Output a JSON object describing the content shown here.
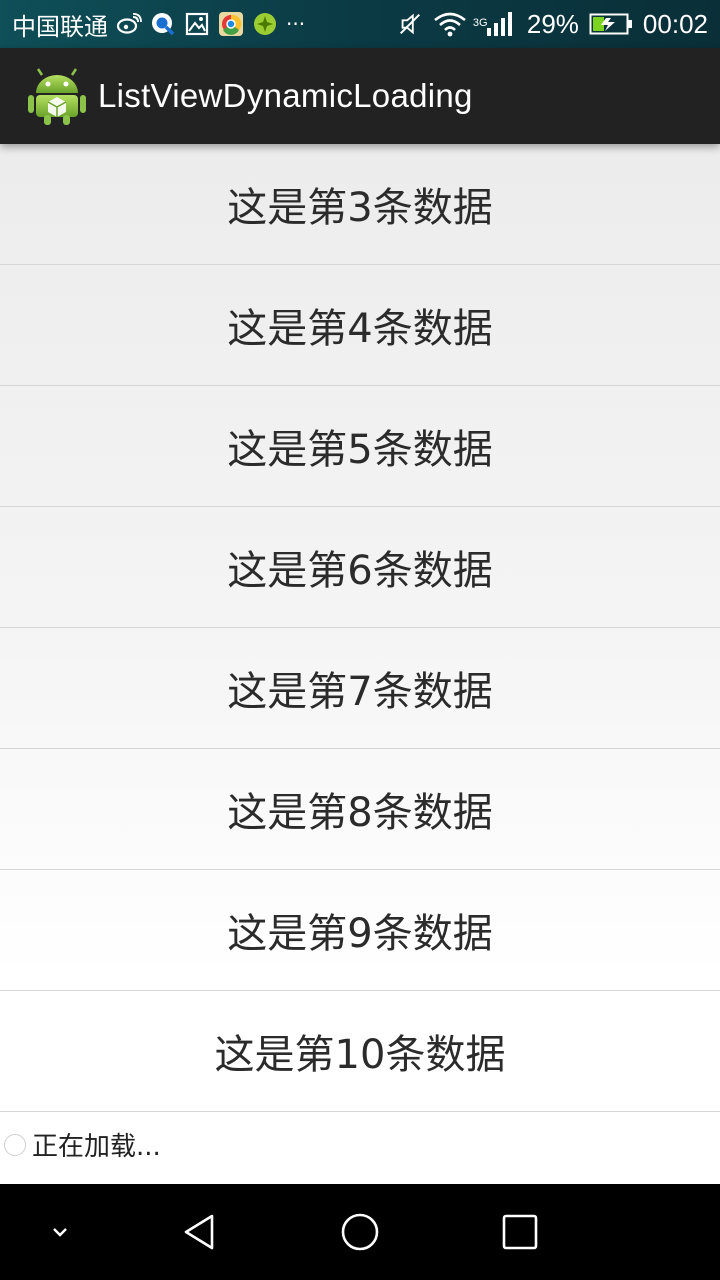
{
  "status_bar": {
    "carrier": "中国联通",
    "network_type": "3G",
    "battery_percent": "29%",
    "time": "00:02",
    "more_indicator": "···",
    "icons": [
      "weibo-icon",
      "q-browser-icon",
      "gallery-icon",
      "chrome-icon",
      "green-app-icon",
      "mute-icon",
      "wifi-icon",
      "signal-icon",
      "battery-charging-icon"
    ]
  },
  "action_bar": {
    "title": "ListViewDynamicLoading",
    "app_icon": "android-icon"
  },
  "list": {
    "items": [
      {
        "text": "这是第3条数据"
      },
      {
        "text": "这是第4条数据"
      },
      {
        "text": "这是第5条数据"
      },
      {
        "text": "这是第6条数据"
      },
      {
        "text": "这是第7条数据"
      },
      {
        "text": "这是第8条数据"
      },
      {
        "text": "这是第9条数据"
      },
      {
        "text": "这是第10条数据"
      }
    ],
    "footer_text": "正在加载..."
  },
  "nav_bar": {
    "buttons": [
      "collapse-icon",
      "back-icon",
      "home-icon",
      "recents-icon"
    ]
  },
  "colors": {
    "status_bar": "#0f4f58",
    "action_bar": "#222222",
    "android_green": "#8bc34a",
    "row_text": "#2b2b2b",
    "divider": "#d6d6d6"
  }
}
